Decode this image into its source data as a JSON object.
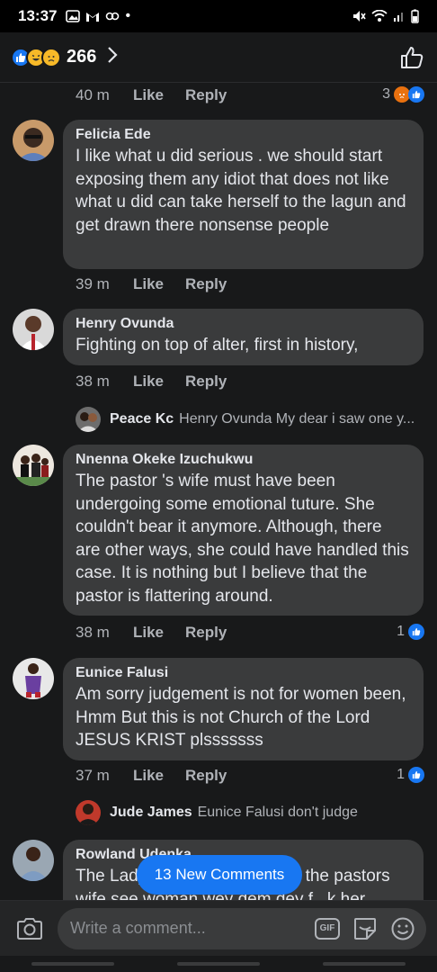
{
  "status": {
    "time": "13:37"
  },
  "header": {
    "reaction_count": "266"
  },
  "top_meta": {
    "time": "40 m",
    "like": "Like",
    "reply": "Reply",
    "likes": "3"
  },
  "comments": [
    {
      "name": "Felicia Ede",
      "text": "I like what u did serious . we should start exposing them any idiot that does not like what u did can take herself to the lagun and get drawn there nonsense people",
      "time": "39 m",
      "like": "Like",
      "reply": "Reply"
    },
    {
      "name": "Henry Ovunda",
      "text": "Fighting on top of alter, first in history,",
      "time": "38 m",
      "like": "Like",
      "reply": "Reply",
      "reply_preview": {
        "name": "Peace Kc",
        "text": "Henry Ovunda My dear i saw one y..."
      }
    },
    {
      "name": "Nnenna Okeke Izuchukwu",
      "text": "The pastor 's wife  must have been undergoing some emotional tuture. She couldn't  bear it anymore. Although, there are other  ways, she could have handled this case. It is nothing but I believe that the pastor is flattering  around.",
      "time": "38 m",
      "like": "Like",
      "reply": "Reply",
      "likes": "1"
    },
    {
      "name": "Eunice Falusi",
      "text": "Am sorry judgement is not for women been, Hmm But this is not Church of the Lord JESUS KRIST plsssssss",
      "time": "37 m",
      "like": "Like",
      "reply": "Reply",
      "likes": "1",
      "reply_preview": {
        "name": "Jude James",
        "text": "Eunice Falusi don't judge"
      }
    },
    {
      "name": "Rowland Udenka",
      "text": "The Lady who is busy fighting the pastors wife see woman wey dem dey f...k her"
    }
  ],
  "new_comments_label": "13 New Comments",
  "composer": {
    "placeholder": "Write a comment..."
  },
  "colors": {
    "accent": "#1877f2",
    "bubble": "#3a3b3c",
    "background": "#18191a"
  }
}
